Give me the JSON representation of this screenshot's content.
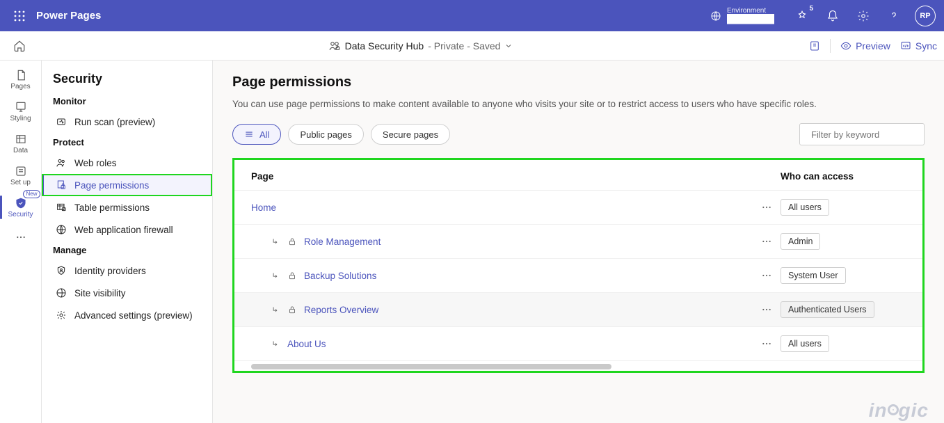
{
  "top": {
    "brand": "Power Pages",
    "env_label": "Environment",
    "env_name": "████████",
    "notif_count": "5",
    "avatar_initials": "RP"
  },
  "cmd": {
    "site_name": "Data Security Hub",
    "site_status": " - Private - Saved",
    "preview": "Preview",
    "sync": "Sync"
  },
  "rail": {
    "pages": "Pages",
    "styling": "Styling",
    "data": "Data",
    "setup": "Set up",
    "security": "Security",
    "new_pill": "New"
  },
  "nav": {
    "title": "Security",
    "monitor": "Monitor",
    "run_scan": "Run scan (preview)",
    "protect": "Protect",
    "web_roles": "Web roles",
    "page_permissions": "Page permissions",
    "table_permissions": "Table permissions",
    "waf": "Web application firewall",
    "manage": "Manage",
    "identity": "Identity providers",
    "visibility": "Site visibility",
    "advanced": "Advanced settings (preview)"
  },
  "main": {
    "title": "Page permissions",
    "desc": "You can use page permissions to make content available to anyone who visits your site or to restrict access to users who have specific roles.",
    "filters": {
      "all": "All",
      "public": "Public pages",
      "secure": "Secure pages"
    },
    "search_placeholder": "Filter by keyword",
    "columns": {
      "page": "Page",
      "access": "Who can access"
    },
    "rows": [
      {
        "name": "Home",
        "indent": false,
        "locked": false,
        "access": "All users"
      },
      {
        "name": "Role Management",
        "indent": true,
        "locked": true,
        "access": "Admin"
      },
      {
        "name": "Backup Solutions",
        "indent": true,
        "locked": true,
        "access": "System User"
      },
      {
        "name": "Reports Overview",
        "indent": true,
        "locked": true,
        "access": "Authenticated Users",
        "hover": true
      },
      {
        "name": "About Us",
        "indent": true,
        "locked": false,
        "access": "All users"
      }
    ]
  },
  "watermark": "inogic"
}
